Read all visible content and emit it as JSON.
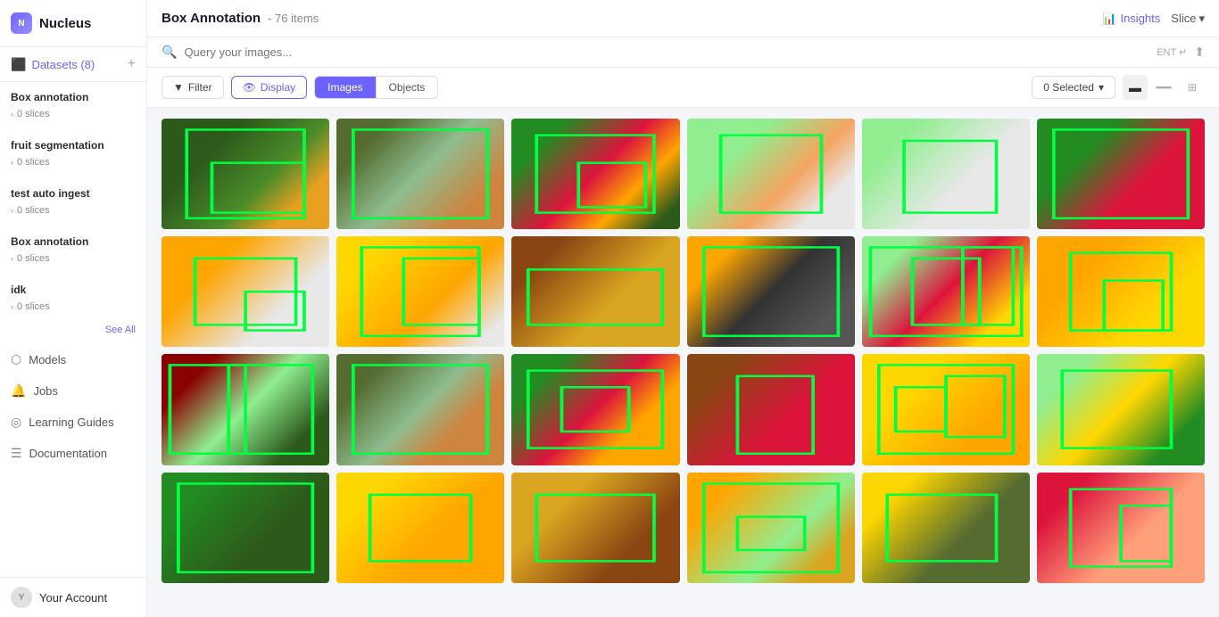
{
  "app": {
    "name": "Nucleus"
  },
  "sidebar": {
    "datasets_label": "Datasets (8)",
    "sections": [
      {
        "title": "Box annotation",
        "slices": "0 slices"
      },
      {
        "title": "fruit segmentation",
        "slices": "0 slices"
      },
      {
        "title": "test auto ingest",
        "slices": "0 slices"
      },
      {
        "title": "Box annotation",
        "slices": "0 slices"
      },
      {
        "title": "idk",
        "slices": "0 slices"
      }
    ],
    "see_all": "See All",
    "nav_items": [
      {
        "label": "Models",
        "icon": "⬡"
      },
      {
        "label": "Jobs",
        "icon": "🔔"
      },
      {
        "label": "Learning Guides",
        "icon": "⊙"
      },
      {
        "label": "Documentation",
        "icon": "☰"
      }
    ],
    "account_label": "Your Account"
  },
  "header": {
    "title": "Box Annotation",
    "count": "- 76 items",
    "insights_label": "Insights",
    "slice_label": "Slice"
  },
  "search": {
    "placeholder": "Query your images...",
    "enter_hint": "ENT ↵"
  },
  "toolbar": {
    "filter_label": "Filter",
    "display_label": "Display",
    "tabs": [
      "Images",
      "Objects"
    ],
    "active_tab": "Images",
    "selected_label": "0 Selected",
    "view_modes": [
      "list",
      "dash",
      "grid"
    ]
  },
  "grid": {
    "images": [
      {
        "id": 1,
        "color_class": "fruit-1",
        "has_bbox": true
      },
      {
        "id": 2,
        "color_class": "fruit-2",
        "has_bbox": true
      },
      {
        "id": 3,
        "color_class": "fruit-3",
        "has_bbox": true
      },
      {
        "id": 4,
        "color_class": "fruit-4",
        "has_bbox": true
      },
      {
        "id": 5,
        "color_class": "fruit-5",
        "has_bbox": true
      },
      {
        "id": 6,
        "color_class": "fruit-6",
        "has_bbox": true
      },
      {
        "id": 7,
        "color_class": "fruit-7",
        "has_bbox": true
      },
      {
        "id": 8,
        "color_class": "fruit-8",
        "has_bbox": true
      },
      {
        "id": 9,
        "color_class": "fruit-9",
        "has_bbox": true
      },
      {
        "id": 10,
        "color_class": "fruit-10",
        "has_bbox": true
      },
      {
        "id": 11,
        "color_class": "fruit-11",
        "has_bbox": true
      },
      {
        "id": 12,
        "color_class": "fruit-12",
        "has_bbox": true
      },
      {
        "id": 13,
        "color_class": "fruit-13",
        "has_bbox": true
      },
      {
        "id": 14,
        "color_class": "fruit-14",
        "has_bbox": true
      },
      {
        "id": 15,
        "color_class": "fruit-15",
        "has_bbox": true
      },
      {
        "id": 16,
        "color_class": "fruit-16",
        "has_bbox": true
      },
      {
        "id": 17,
        "color_class": "fruit-17",
        "has_bbox": true
      },
      {
        "id": 18,
        "color_class": "fruit-18",
        "has_bbox": true
      },
      {
        "id": 19,
        "color_class": "fruit-19",
        "has_bbox": true
      },
      {
        "id": 20,
        "color_class": "fruit-20",
        "has_bbox": true
      },
      {
        "id": 21,
        "color_class": "fruit-21",
        "has_bbox": true
      },
      {
        "id": 22,
        "color_class": "fruit-22",
        "has_bbox": true
      },
      {
        "id": 23,
        "color_class": "fruit-23",
        "has_bbox": true
      },
      {
        "id": 24,
        "color_class": "fruit-24",
        "has_bbox": true
      }
    ]
  }
}
